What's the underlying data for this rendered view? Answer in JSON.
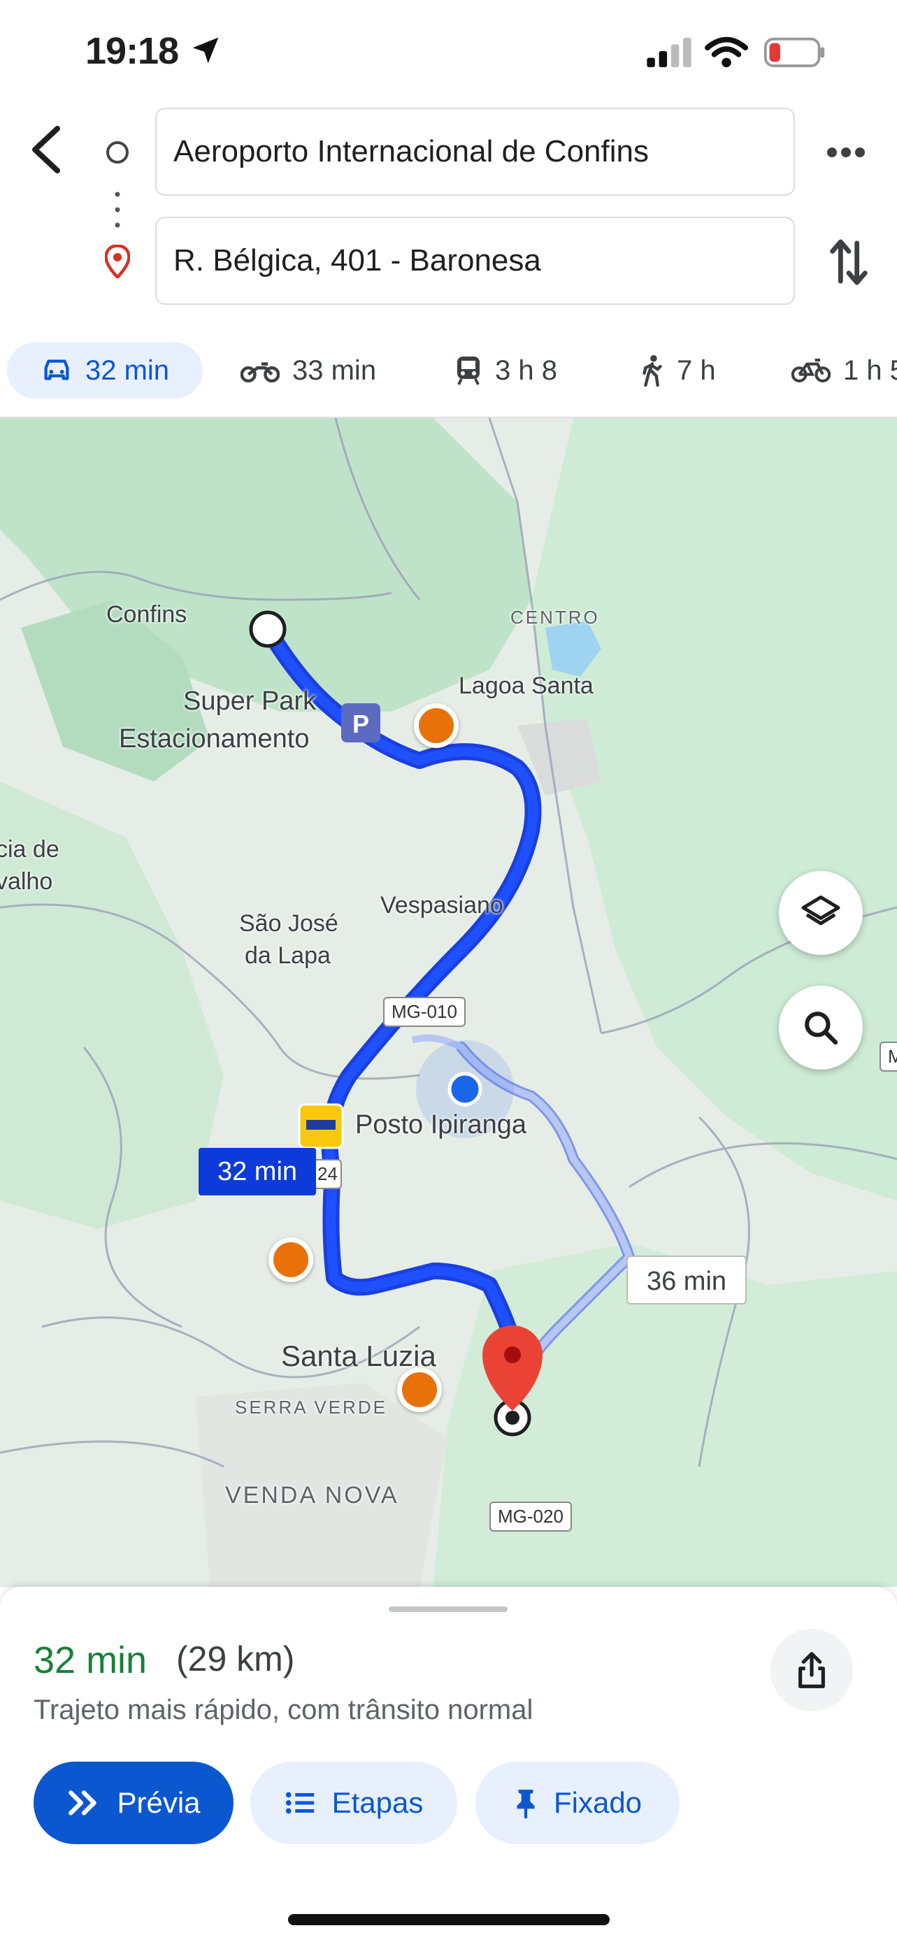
{
  "status_bar": {
    "time": "19:18"
  },
  "route": {
    "origin": "Aeroporto Internacional de Confins",
    "destination": "R. Bélgica, 401 - Baronesa"
  },
  "modes": [
    {
      "icon": "car-icon",
      "label": "32 min",
      "selected": true
    },
    {
      "icon": "motorcycle-icon",
      "label": "33 min"
    },
    {
      "icon": "transit-icon",
      "label": "3 h 8"
    },
    {
      "icon": "walk-icon",
      "label": "7 h"
    },
    {
      "icon": "bike-icon",
      "label": "1 h 5"
    }
  ],
  "map": {
    "labels": {
      "confins": "Confins",
      "centro": "CENTRO",
      "lagoa_santa": "Lagoa Santa",
      "super_park": "Super Park",
      "estacionamento": "Estacionamento",
      "vespasiano": "Vespasiano",
      "sao_jose": "São José",
      "da_lapa": "da Lapa",
      "posto": "Posto Ipiranga",
      "santa_luzia": "Santa Luzia",
      "serra_verde": "SERRA VERDE",
      "venda_nova": "VENDA NOVA",
      "left_edge_1": "cia de",
      "left_edge_2": "valho",
      "right_edge": "M",
      "shield_24": "24"
    },
    "shields": {
      "mg010": "MG-010",
      "mg020": "MG-020"
    },
    "route_time_primary": "32 min",
    "route_time_alt": "36 min",
    "colors": {
      "route": "#1a3fe0",
      "alt_route": "#9fb3f0",
      "park": "#c2e6cc",
      "water": "#9fd4f0"
    }
  },
  "summary": {
    "time": "32 min",
    "distance": "(29 km)",
    "description": "Trajeto mais rápido, com trânsito normal"
  },
  "actions": {
    "preview": "Prévia",
    "steps": "Etapas",
    "pinned": "Fixado"
  }
}
